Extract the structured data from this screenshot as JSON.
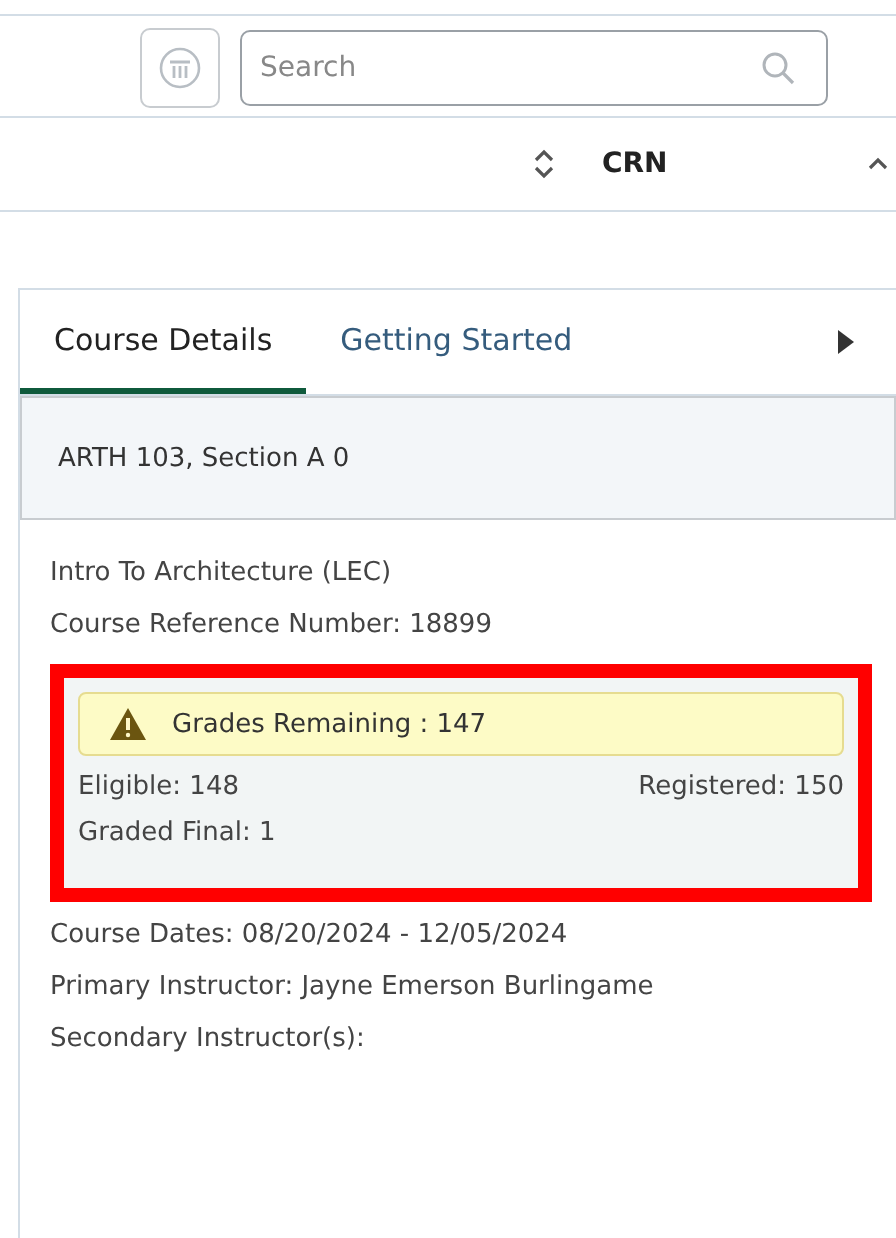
{
  "toolbar": {
    "search": {
      "placeholder": "Search"
    }
  },
  "table": {
    "columns": [
      {
        "label": "CRN"
      }
    ]
  },
  "panel": {
    "tabs": [
      {
        "label": "Course Details",
        "selected": true
      },
      {
        "label": "Getting Started",
        "selected": false
      }
    ],
    "section_title": "ARTH 103, Section A 0",
    "lines_top": [
      "Intro To Architecture (LEC)",
      "Course Reference Number: 18899"
    ],
    "alert": {
      "text": "Grades Remaining : 147",
      "eligible": "Eligible: 148",
      "registered": "Registered: 150",
      "graded_final": "Graded Final: 1"
    },
    "lines_bottom": [
      "Course Dates: 08/20/2024 - 12/05/2024",
      "Primary Instructor: Jayne Emerson Burlingame",
      "Secondary Instructor(s):"
    ]
  }
}
